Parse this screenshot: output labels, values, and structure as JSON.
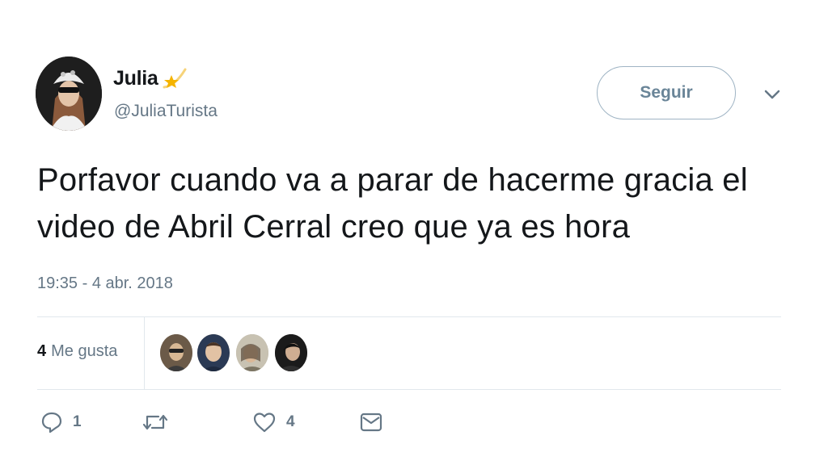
{
  "user": {
    "display_name": "Julia",
    "handle": "@JuliaTurista",
    "badge_icon": "shooting-star-icon"
  },
  "header": {
    "follow_label": "Seguir",
    "menu_icon": "chevron-down-icon"
  },
  "tweet": {
    "text": "Porfavor cuando va a parar de hacerme gracia el video de Abril Cerral creo que ya es hora",
    "timestamp": "19:35 - 4 abr. 2018"
  },
  "stats": {
    "likes_count": "4",
    "likes_label": "Me gusta",
    "likers": [
      "liker-avatar-1",
      "liker-avatar-2",
      "liker-avatar-3",
      "liker-avatar-4"
    ]
  },
  "actions": {
    "reply_count": "1",
    "retweet_count": "",
    "like_count": "4"
  },
  "colors": {
    "text": "#14171a",
    "secondary": "#657786",
    "divider": "#e1e8ed",
    "follow_border": "#9fb4c4",
    "star": "#f5b400"
  }
}
